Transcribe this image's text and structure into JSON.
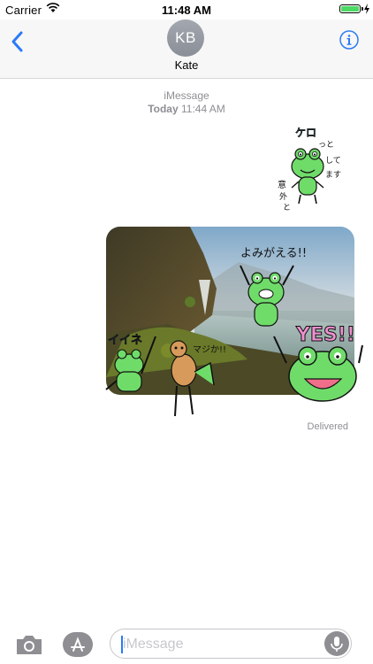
{
  "status_bar": {
    "carrier": "Carrier",
    "time": "11:48 AM"
  },
  "header": {
    "avatar_initials": "KB",
    "contact_name": "Kate"
  },
  "transcript": {
    "service": "iMessage",
    "day": "Today",
    "time": "11:44 AM",
    "status": "Delivered"
  },
  "stickers": {
    "top_sticker": [
      "ケロ",
      "っと",
      "して",
      "ます",
      "意",
      "外",
      "と"
    ],
    "overlay": [
      "よみがえる!!",
      "YES!!",
      "イイネ",
      "マジか!!"
    ]
  },
  "input": {
    "placeholder": "iMessage"
  },
  "colors": {
    "accent": "#2a7bf6",
    "frog": "#6fdc6a",
    "battery": "#4cd964"
  }
}
